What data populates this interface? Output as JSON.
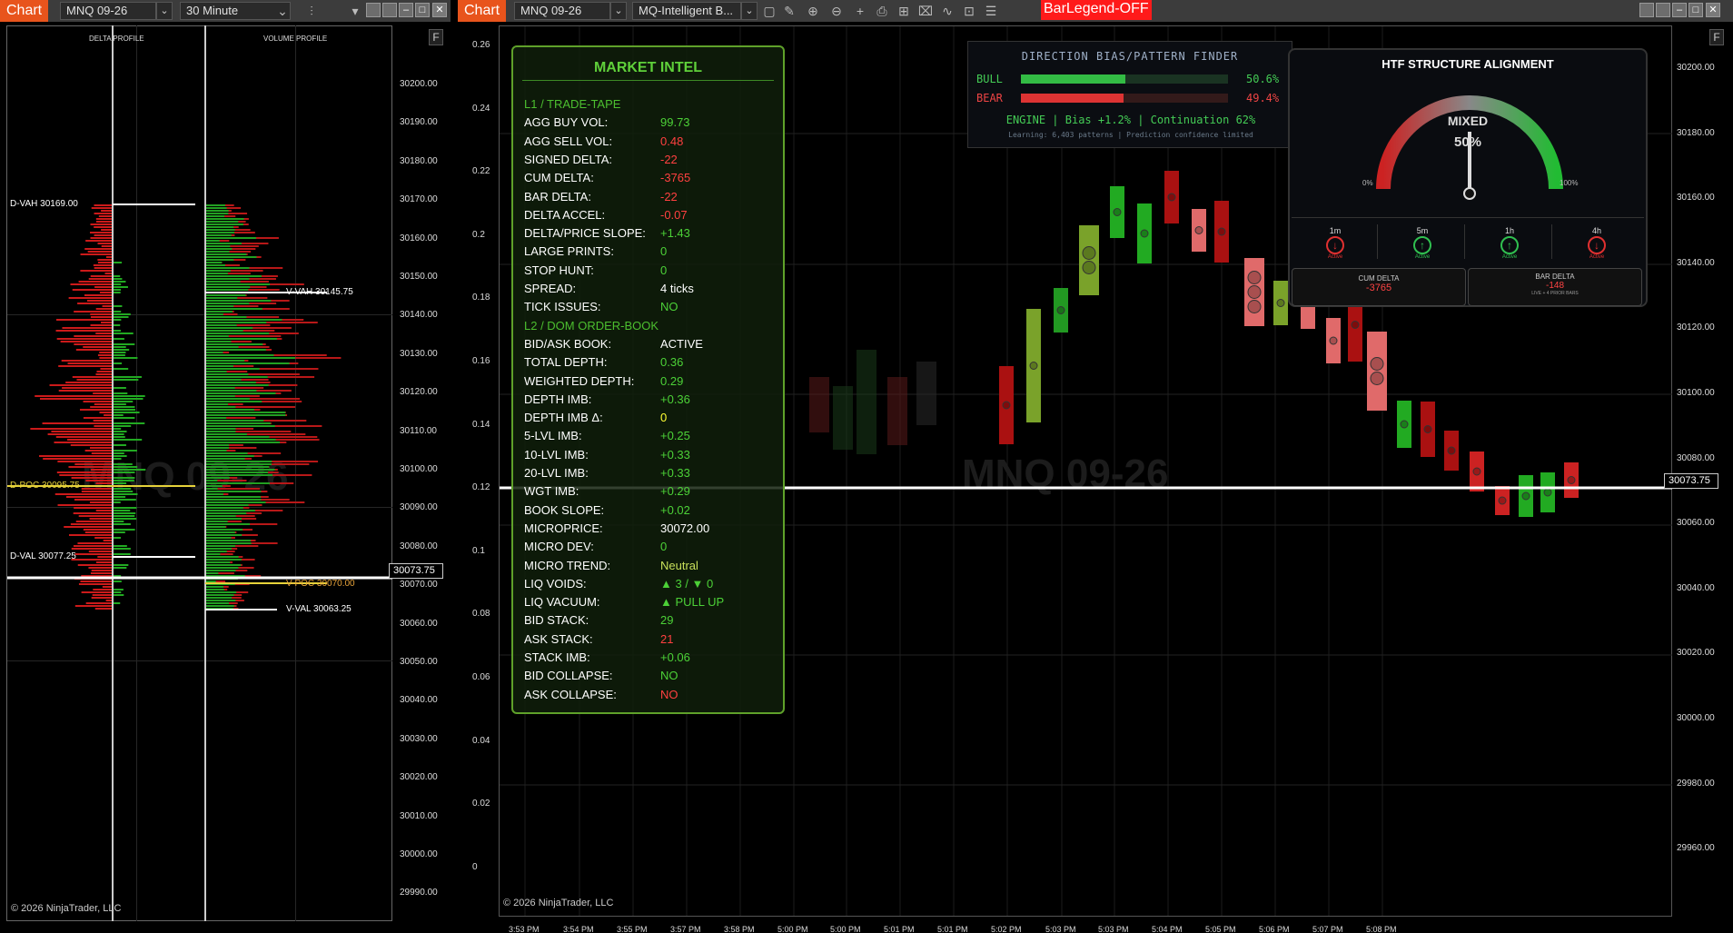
{
  "left_window": {
    "chart_tag": "Chart",
    "instrument": "MNQ 09-26",
    "interval": "30 Minute",
    "delta_profile_label": "DELTA PROFILE",
    "volume_profile_label": "VOLUME PROFILE",
    "f_button": "F",
    "watermark": "MNQ 09-26",
    "copyright": "© 2026 NinjaTrader, LLC",
    "price_ticks": [
      "30200.00",
      "30190.00",
      "30180.00",
      "30170.00",
      "30160.00",
      "30150.00",
      "30140.00",
      "30130.00",
      "30120.00",
      "30110.00",
      "30100.00",
      "30090.00",
      "30080.00",
      "30070.00",
      "30060.00",
      "30050.00",
      "30040.00",
      "30030.00",
      "30020.00",
      "30010.00",
      "30000.00",
      "29990.00"
    ],
    "current_price": "30073.75",
    "levels": {
      "d_vah": "D-VAH 30169.00",
      "d_poc": "D-POC 30095.75",
      "d_val": "D-VAL 30077.25",
      "v_vah": "V-VAH 30145.75",
      "v_poc": "V-POC 30070.00",
      "v_val": "V-VAL 30063.25"
    }
  },
  "right_window": {
    "chart_tag": "Chart",
    "instrument": "MNQ 09-26",
    "indicator": "MQ-Intelligent B...",
    "bar_legend": "BarLegend-OFF",
    "f_button": "F",
    "watermark": "MNQ 09-26",
    "copyright": "© 2026 NinjaTrader, LLC",
    "current_price": "30073.75",
    "left_ticks": [
      "0.26",
      "0.24",
      "0.22",
      "0.2",
      "0.18",
      "0.16",
      "0.14",
      "0.12",
      "0.1",
      "0.08",
      "0.06",
      "0.04",
      "0.02",
      "0"
    ],
    "right_ticks": [
      "30200.00",
      "30180.00",
      "30160.00",
      "30140.00",
      "30120.00",
      "30100.00",
      "30080.00",
      "30060.00",
      "30040.00",
      "30020.00",
      "30000.00",
      "29980.00",
      "29960.00"
    ],
    "time_ticks": [
      "3:53 PM",
      "3:54 PM",
      "3:55 PM",
      "3:57 PM",
      "3:58 PM",
      "5:00 PM",
      "5:00 PM",
      "5:01 PM",
      "5:01 PM",
      "5:02 PM",
      "5:03 PM",
      "5:03 PM",
      "5:04 PM",
      "5:05 PM",
      "5:06 PM",
      "5:07 PM",
      "5:08 PM"
    ]
  },
  "market_intel": {
    "title": "MARKET INTEL",
    "rows": [
      {
        "k": "L1 / TRADE-TAPE",
        "v": "",
        "section": true
      },
      {
        "k": "AGG BUY VOL:",
        "v": "99.73",
        "c": "#4cd137"
      },
      {
        "k": "AGG SELL VOL:",
        "v": "0.48",
        "c": "#ff4040"
      },
      {
        "k": "SIGNED DELTA:",
        "v": "-22",
        "c": "#ff4040"
      },
      {
        "k": "CUM DELTA:",
        "v": "-3765",
        "c": "#ff4040"
      },
      {
        "k": "BAR DELTA:",
        "v": "-22",
        "c": "#ff4040"
      },
      {
        "k": "DELTA ACCEL:",
        "v": "-0.07",
        "c": "#ff4040"
      },
      {
        "k": "DELTA/PRICE SLOPE:",
        "v": "+1.43",
        "c": "#4cd137"
      },
      {
        "k": "LARGE PRINTS:",
        "v": "0",
        "c": "#4cd137"
      },
      {
        "k": "STOP HUNT:",
        "v": "0",
        "c": "#4cd137"
      },
      {
        "k": "SPREAD:",
        "v": "4 ticks",
        "c": "#ffffff"
      },
      {
        "k": "TICK ISSUES:",
        "v": "NO",
        "c": "#4cd137"
      },
      {
        "k": "L2 / DOM ORDER-BOOK",
        "v": "",
        "section": true
      },
      {
        "k": "BID/ASK BOOK:",
        "v": "ACTIVE",
        "c": "#ffffff"
      },
      {
        "k": "TOTAL DEPTH:",
        "v": "0.36",
        "c": "#4cd137"
      },
      {
        "k": "WEIGHTED DEPTH:",
        "v": "0.29",
        "c": "#4cd137"
      },
      {
        "k": "DEPTH IMB:",
        "v": "+0.36",
        "c": "#4cd137"
      },
      {
        "k": "DEPTH IMB Δ:",
        "v": "0",
        "c": "#ffff33"
      },
      {
        "k": "5-LVL IMB:",
        "v": "+0.25",
        "c": "#4cd137"
      },
      {
        "k": "10-LVL IMB:",
        "v": "+0.33",
        "c": "#4cd137"
      },
      {
        "k": "20-LVL IMB:",
        "v": "+0.33",
        "c": "#4cd137"
      },
      {
        "k": "WGT IMB:",
        "v": "+0.29",
        "c": "#4cd137"
      },
      {
        "k": "BOOK SLOPE:",
        "v": "+0.02",
        "c": "#4cd137"
      },
      {
        "k": "MICROPRICE:",
        "v": "30072.00",
        "c": "#ffffff"
      },
      {
        "k": "MICRO DEV:",
        "v": "0",
        "c": "#4cd137"
      },
      {
        "k": "MICRO TREND:",
        "v": "Neutral",
        "c": "#c8e05a"
      },
      {
        "k": "LIQ VOIDS:",
        "v": "▲ 3 / ▼ 0",
        "c": "#4cd137"
      },
      {
        "k": "LIQ VACUUM:",
        "v": "▲ PULL UP",
        "c": "#4cd137"
      },
      {
        "k": "BID STACK:",
        "v": "29",
        "c": "#4cd137"
      },
      {
        "k": "ASK STACK:",
        "v": "21",
        "c": "#ff4040"
      },
      {
        "k": "STACK IMB:",
        "v": "+0.06",
        "c": "#4cd137"
      },
      {
        "k": "BID COLLAPSE:",
        "v": "NO",
        "c": "#4cd137"
      },
      {
        "k": "ASK COLLAPSE:",
        "v": "NO",
        "c": "#ff4040"
      }
    ]
  },
  "direction_bias": {
    "title": "DIRECTION BIAS/PATTERN FINDER",
    "bull_label": "BULL",
    "bull_value": "50.6%",
    "bull_fraction": 0.506,
    "bear_label": "BEAR",
    "bear_value": "49.4%",
    "bear_fraction": 0.494,
    "engine_line": "ENGINE | Bias +1.2% | Continuation 62%",
    "learning_line": "Learning: 6,403 patterns | Prediction confidence limited"
  },
  "htf": {
    "title": "HTF STRUCTURE ALIGNMENT",
    "gauge_label": "MIXED",
    "gauge_value": "50%",
    "gauge_fraction": 0.5,
    "min_label": "0%",
    "max_label": "100%",
    "timeframes": [
      {
        "name": "1m",
        "status": "Active",
        "color": "#e03030",
        "arrow": "↓"
      },
      {
        "name": "5m",
        "status": "Active",
        "color": "#30c050",
        "arrow": "↑"
      },
      {
        "name": "1h",
        "status": "Active",
        "color": "#30c050",
        "arrow": "↑"
      },
      {
        "name": "4h",
        "status": "Active",
        "color": "#e03030",
        "arrow": "↓"
      }
    ],
    "cum_delta_label": "CUM DELTA",
    "cum_delta_value": "-3765",
    "bar_delta_label": "BAR DELTA",
    "bar_delta_value": "-148",
    "bar_delta_sub": "LIVE + 4 PRIOR BARS"
  },
  "colors": {
    "accent": "#e8541c",
    "bull": "#22aa22",
    "bear": "#cc1a1a",
    "bar_legend_bg": "#ff1a1a"
  }
}
